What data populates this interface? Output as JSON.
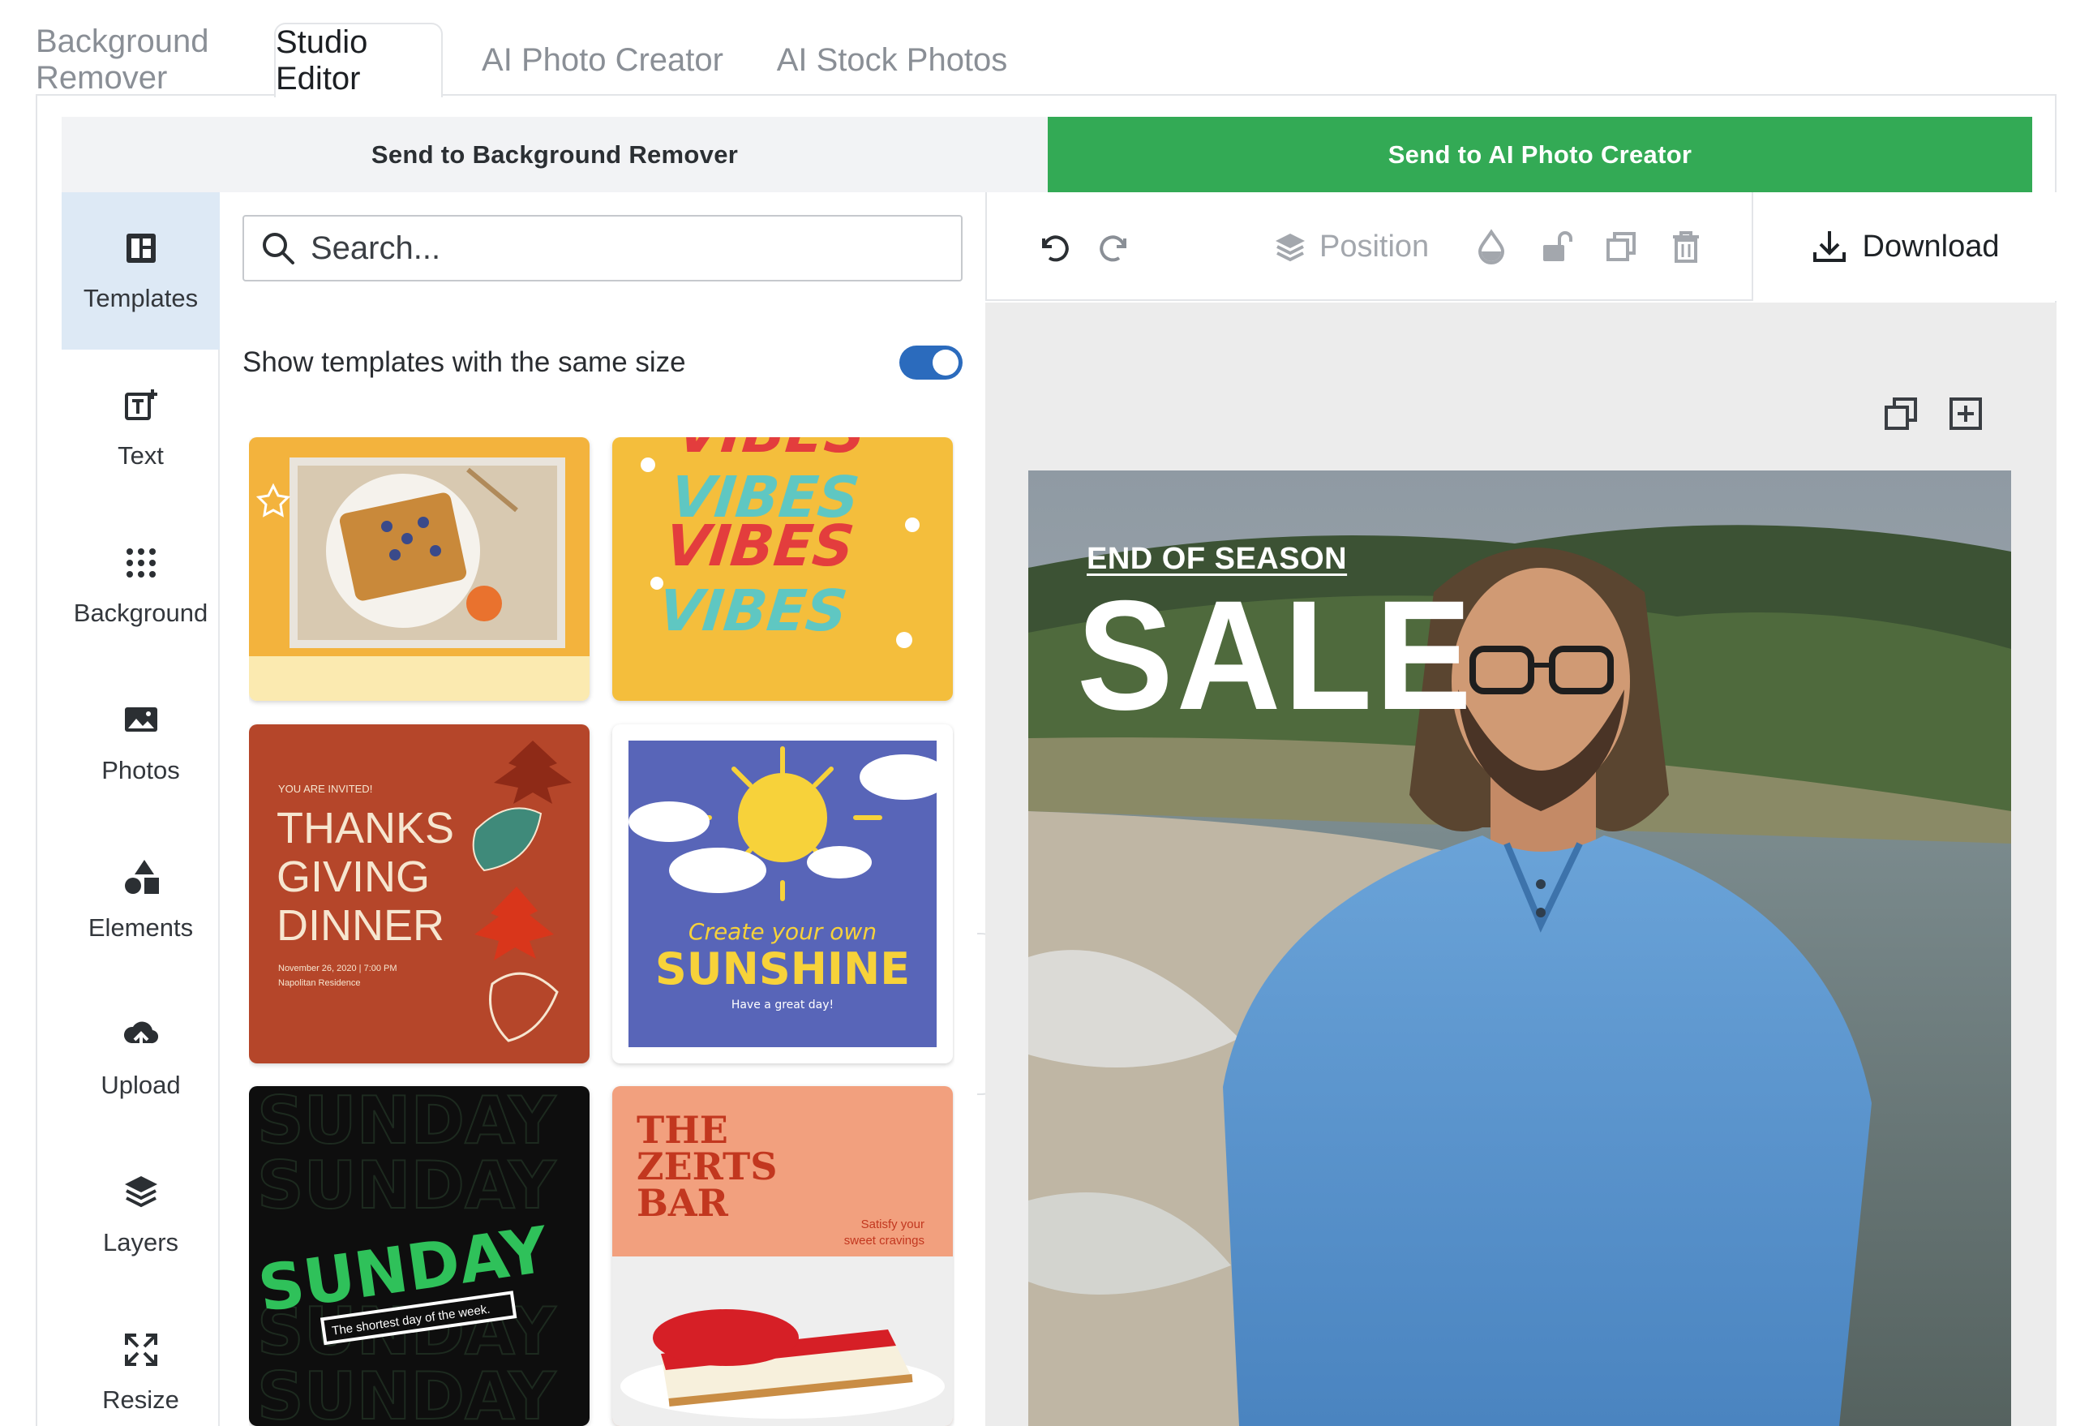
{
  "tabs": [
    {
      "label": "Background Remover",
      "active": false
    },
    {
      "label": "Studio Editor",
      "active": true
    },
    {
      "label": "AI Photo Creator",
      "active": false
    },
    {
      "label": "AI Stock Photos",
      "active": false
    }
  ],
  "send_bar": {
    "left_label": "Send to Background Remover",
    "right_label": "Send to AI Photo Creator",
    "accent_color": "#33aa55"
  },
  "rail": {
    "items": [
      {
        "label": "Templates",
        "icon": "templates-icon",
        "active": true
      },
      {
        "label": "Text",
        "icon": "text-icon",
        "active": false
      },
      {
        "label": "Background",
        "icon": "background-icon",
        "active": false
      },
      {
        "label": "Photos",
        "icon": "photos-icon",
        "active": false
      },
      {
        "label": "Elements",
        "icon": "elements-icon",
        "active": false
      },
      {
        "label": "Upload",
        "icon": "upload-icon",
        "active": false
      },
      {
        "label": "Layers",
        "icon": "layers-icon",
        "active": false
      },
      {
        "label": "Resize",
        "icon": "resize-icon",
        "active": false
      }
    ]
  },
  "panel": {
    "search_placeholder": "Search...",
    "toggle_label": "Show templates with the same size",
    "toggle_on": true,
    "templates": [
      {
        "name": "waffles-photo",
        "text": ""
      },
      {
        "name": "vibes",
        "text": "VIBES"
      },
      {
        "name": "thanksgiving",
        "invite": "YOU ARE INVITED!",
        "line1": "THANKS",
        "line2": "GIVING",
        "line3": "DINNER",
        "details": "November 26, 2020 | 7:00 PM",
        "place": "Napolitan Residence"
      },
      {
        "name": "sunshine",
        "script": "Create your own",
        "title": "SUNSHINE",
        "sub": "Have a great day!"
      },
      {
        "name": "sunday",
        "title": "SUNDAY",
        "sub": "The shortest day of the week."
      },
      {
        "name": "zerts-bar",
        "line1": "THE",
        "line2": "ZERTS",
        "line3": "BAR",
        "sub1": "Satisfy your",
        "sub2": "sweet cravings"
      }
    ]
  },
  "toolbar": {
    "position_label": "Position",
    "download_label": "Download"
  },
  "canvas": {
    "headline_small": "END OF SEASON",
    "headline_big": "SALE"
  }
}
